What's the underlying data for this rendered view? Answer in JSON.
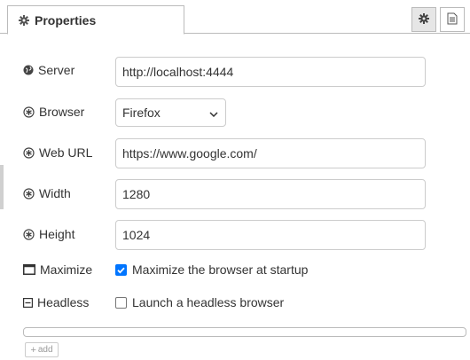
{
  "tab": {
    "title": "Properties"
  },
  "toolbar": {
    "settings_icon": "gear-icon",
    "info_icon": "document-icon"
  },
  "fields": {
    "server": {
      "label": "Server",
      "value": "http://localhost:4444"
    },
    "browser": {
      "label": "Browser",
      "value": "Firefox",
      "options": [
        "Firefox"
      ]
    },
    "web_url": {
      "label": "Web URL",
      "value": "https://www.google.com/"
    },
    "width": {
      "label": "Width",
      "value": "1280"
    },
    "height": {
      "label": "Height",
      "value": "1024"
    },
    "maximize": {
      "label": "Maximize",
      "text": "Maximize the browser at startup",
      "checked": true
    },
    "headless": {
      "label": "Headless",
      "text": "Launch a headless browser",
      "checked": false
    }
  },
  "add_button": {
    "label": "add"
  },
  "colors": {
    "checkbox_checked": "#0075ff",
    "border": "#bbbbbb"
  }
}
